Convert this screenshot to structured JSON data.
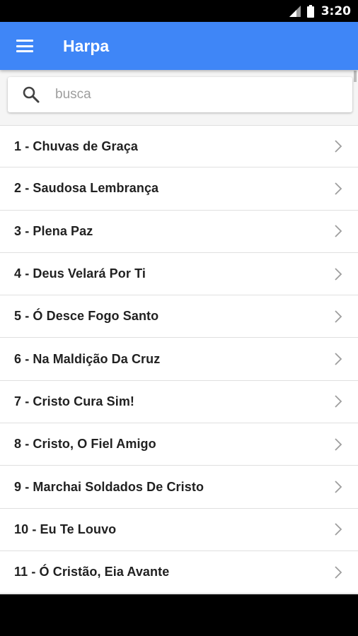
{
  "status_bar": {
    "time": "3:20",
    "signal_icon": "signal-icon",
    "battery_icon": "battery-icon"
  },
  "app_bar": {
    "title": "Harpa",
    "menu_icon": "hamburger-menu-icon",
    "background_color": "#3f86f7"
  },
  "search": {
    "placeholder": "busca",
    "value": "",
    "icon": "search-icon"
  },
  "songs": [
    {
      "label": "1 - Chuvas de Graça"
    },
    {
      "label": "2 - Saudosa Lembrança"
    },
    {
      "label": "3 - Plena Paz"
    },
    {
      "label": "4 - Deus Velará Por Ti"
    },
    {
      "label": "5 - Ó Desce Fogo Santo"
    },
    {
      "label": "6 - Na Maldição Da Cruz"
    },
    {
      "label": "7 - Cristo Cura Sim!"
    },
    {
      "label": "8 - Cristo, O Fiel Amigo"
    },
    {
      "label": "9 - Marchai Soldados De Cristo"
    },
    {
      "label": "10 - Eu Te Louvo"
    },
    {
      "label": "11 - Ó Cristão, Eia Avante"
    }
  ],
  "list_item_icon": "chevron-right-icon"
}
